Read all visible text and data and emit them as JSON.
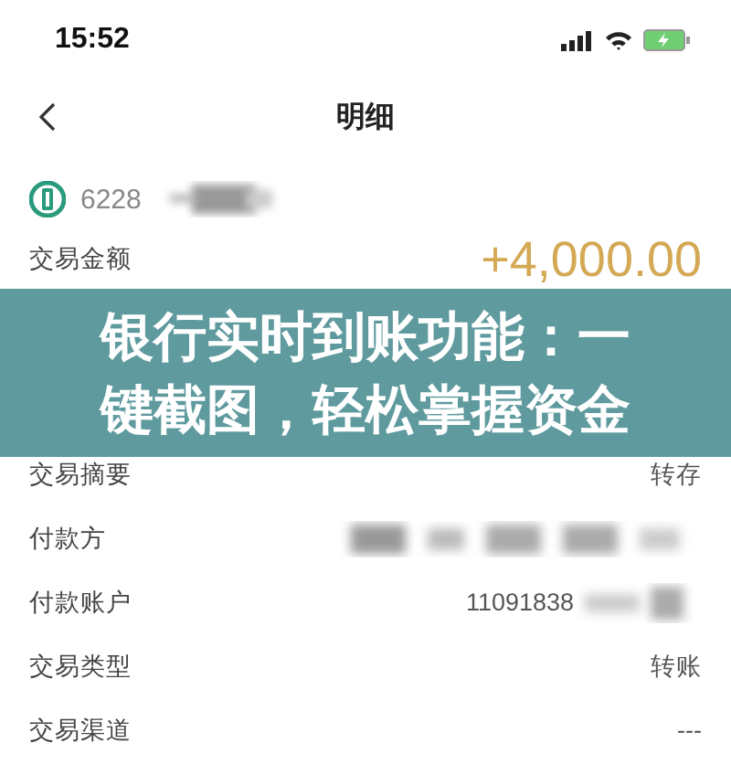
{
  "status_bar": {
    "time": "15:52"
  },
  "nav": {
    "title": "明细"
  },
  "account": {
    "number": "6228"
  },
  "details": [
    {
      "kind": "amount",
      "label": "交易金额",
      "value": "+4,000.00"
    },
    {
      "kind": "text",
      "label": "交易摘要",
      "value": "转存"
    },
    {
      "kind": "blurred",
      "label": "付款方"
    },
    {
      "kind": "partial",
      "label": "付款账户",
      "value": "11091838"
    },
    {
      "kind": "text",
      "label": "交易类型",
      "value": "转账"
    },
    {
      "kind": "text",
      "label": "交易渠道",
      "value": "---"
    }
  ],
  "banner": {
    "text": "银行实时到账功能：一键截图，轻松掌握资金"
  }
}
